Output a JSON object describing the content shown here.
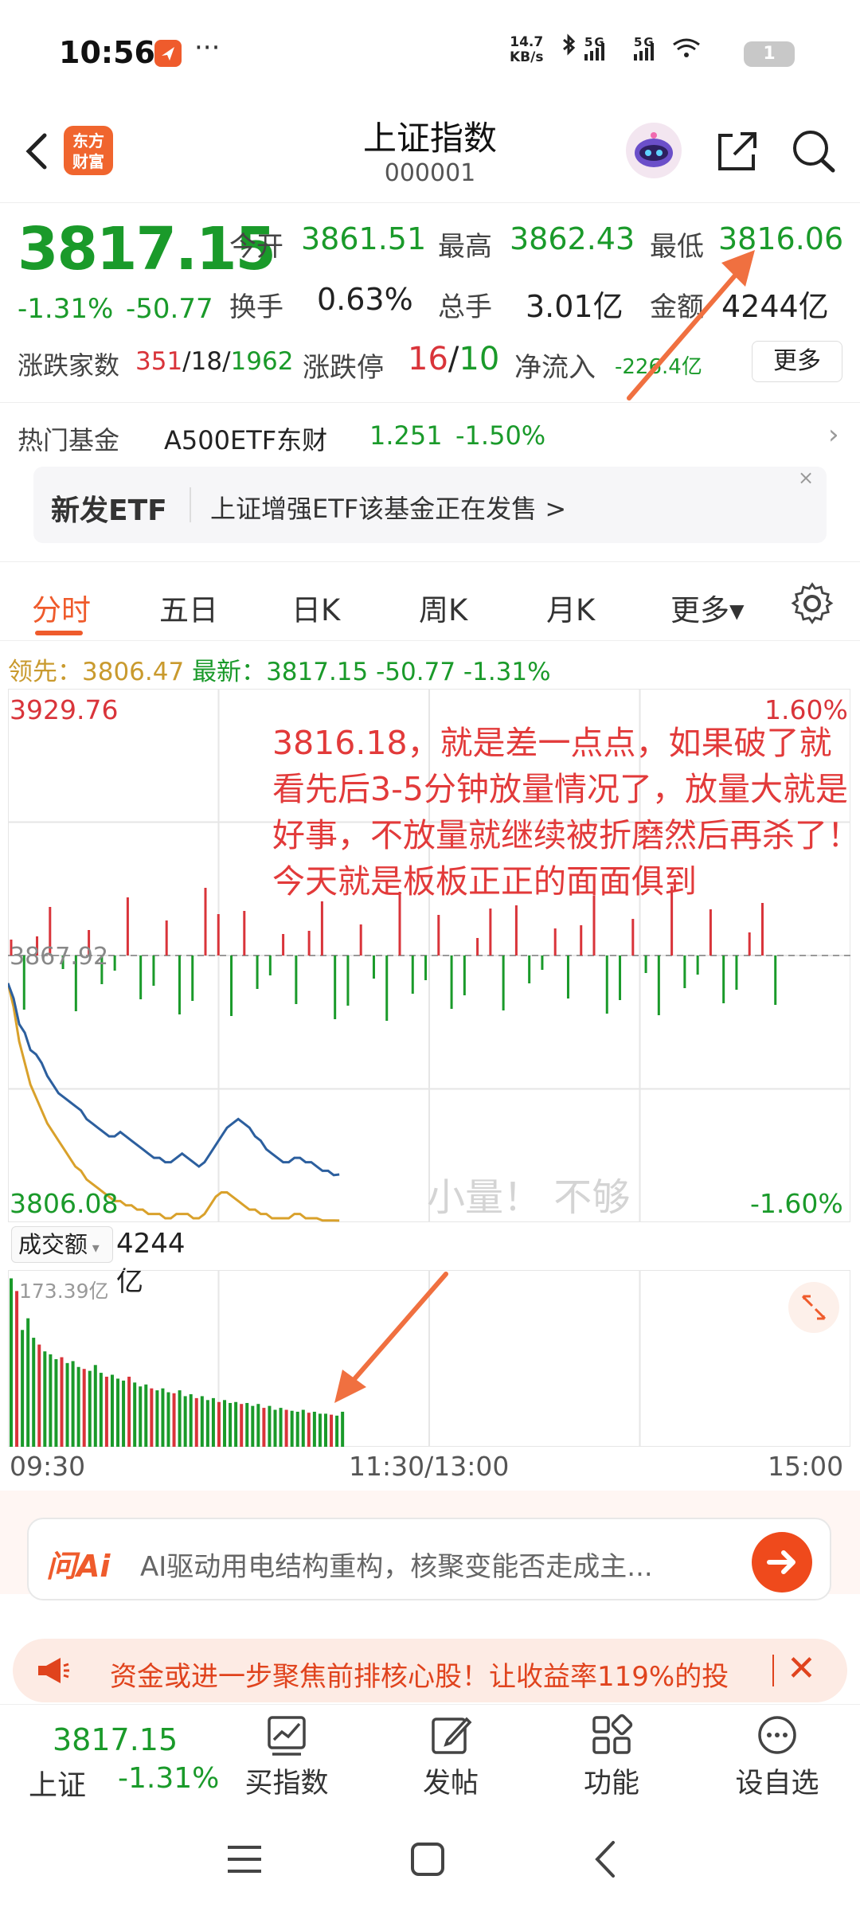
{
  "status_bar": {
    "time": "10:56",
    "dots": "···",
    "net_speed_value": "14.7",
    "net_speed_unit": "KB/s",
    "signal_text": "5G 5G",
    "battery": "1"
  },
  "header": {
    "title": "上证指数",
    "code": "000001",
    "logo_line1": "东方",
    "logo_line2": "财富"
  },
  "quote": {
    "price": "3817.15",
    "change_pct": "-1.31%",
    "change_val": "-50.77",
    "open_label": "今开",
    "open": "3861.51",
    "high_label": "最高",
    "high": "3862.43",
    "low_label": "最低",
    "low": "3816.06",
    "turnover_label": "换手",
    "turnover": "0.63%",
    "volume_label": "总手",
    "volume": "3.01亿",
    "amount_label": "金额",
    "amount": "4244亿",
    "adv_label": "涨跌家数",
    "adv_up": "351",
    "adv_flat": "18",
    "adv_down": "1962",
    "limit_label": "涨跌停",
    "limit_up": "16",
    "limit_down": "10",
    "netflow_label": "净流入",
    "netflow": "-226.4亿",
    "more_label": "更多"
  },
  "hot_fund": {
    "label": "热门基金",
    "name": "A500ETF东财",
    "price": "1.251",
    "change": "-1.50%"
  },
  "etf_banner": {
    "tag": "新发ETF",
    "text": "上证增强ETF该基金正在发售 >",
    "close": "×"
  },
  "tabs": [
    {
      "label": "分时",
      "active": true
    },
    {
      "label": "五日"
    },
    {
      "label": "日K"
    },
    {
      "label": "周K"
    },
    {
      "label": "月K"
    },
    {
      "label": "更多▾"
    }
  ],
  "leader_line": {
    "leader_label": "领先：",
    "leader_value": "3806.47",
    "latest_label": "最新：",
    "latest_value": "3817.15",
    "latest_change": "-50.77",
    "latest_pct": "-1.31%"
  },
  "chart": {
    "y_top": "3929.76",
    "y_bottom": "3806.08",
    "y_mid": "3867.92",
    "pct_top": "1.60%",
    "pct_bottom": "-1.60%",
    "annotation": "3816.18，就是差一点点，如果破了就看先后3-5分钟放量情况了，放量大就是好事，不放量就继续被折磨然后再杀了！今天就是板板正正的面面俱到",
    "watermark": "小量！ 不够",
    "colors": {
      "price_line": "#2c5f9e",
      "avg_line": "#d9a12b",
      "up": "#d9343a",
      "down": "#1a9a2a",
      "arrow": "#f07040"
    }
  },
  "chart_data": {
    "type": "line",
    "title": "",
    "xlabel": "",
    "ylabel": "",
    "ylim": [
      3806.08,
      3929.76
    ],
    "prev_close": 3867.92,
    "x_ticks": [
      "09:30",
      "11:30/13:00",
      "15:00"
    ],
    "series": [
      {
        "values": [
          3861.5,
          3858,
          3852,
          3850,
          3846,
          3845,
          3843,
          3840,
          3838,
          3836,
          3835,
          3834,
          3833,
          3832,
          3830,
          3829,
          3828,
          3827,
          3826,
          3826,
          3827,
          3826,
          3825,
          3824,
          3823,
          3822,
          3821,
          3821,
          3820,
          3820,
          3821,
          3822,
          3821,
          3820,
          3819,
          3820,
          3822,
          3824,
          3826,
          3828,
          3829,
          3830,
          3829,
          3828,
          3826,
          3825,
          3823,
          3822,
          3821,
          3820,
          3820,
          3821,
          3821,
          3820,
          3820,
          3819,
          3818,
          3818,
          3817,
          3817.15
        ]
      },
      {
        "values": [
          3861.5,
          3856,
          3848,
          3843,
          3838,
          3835,
          3832,
          3829,
          3827,
          3825,
          3823,
          3821,
          3819,
          3818,
          3816,
          3815,
          3814,
          3813,
          3812,
          3811,
          3811,
          3810,
          3810,
          3809,
          3809,
          3808,
          3808,
          3808,
          3807,
          3807,
          3808,
          3808,
          3808,
          3807,
          3807,
          3808,
          3810,
          3812,
          3813,
          3813,
          3812,
          3811,
          3810,
          3809,
          3809,
          3808,
          3808,
          3807,
          3807,
          3807,
          3807,
          3808,
          3808,
          3807,
          3807,
          3807,
          3806.5,
          3806.5,
          3806.5,
          3806.47
        ]
      }
    ],
    "volume": {
      "label": "成交额",
      "total": "4244亿",
      "max_label": "173.39亿",
      "values": [
        173,
        160,
        120,
        132,
        112,
        105,
        98,
        95,
        90,
        92,
        86,
        88,
        82,
        80,
        78,
        84,
        76,
        72,
        74,
        70,
        68,
        72,
        66,
        62,
        64,
        60,
        58,
        60,
        56,
        55,
        58,
        52,
        54,
        50,
        52,
        48,
        50,
        46,
        48,
        45,
        46,
        44,
        45,
        42,
        44,
        40,
        42,
        38,
        40,
        38,
        37,
        36,
        38,
        35,
        36,
        34,
        34,
        33,
        32,
        36
      ]
    }
  },
  "ai_bar": {
    "logo": "问Ai",
    "text": "AI驱动用电结构重构，核聚变能否走成主..."
  },
  "promo": {
    "text": "资金或进一步聚焦前排核心股！让收益率119%的投",
    "close": "✕"
  },
  "bottom_nav": {
    "price": "3817.15",
    "name": "上证",
    "change": "-1.31%",
    "items": [
      "买指数",
      "发帖",
      "功能",
      "设自选"
    ]
  }
}
